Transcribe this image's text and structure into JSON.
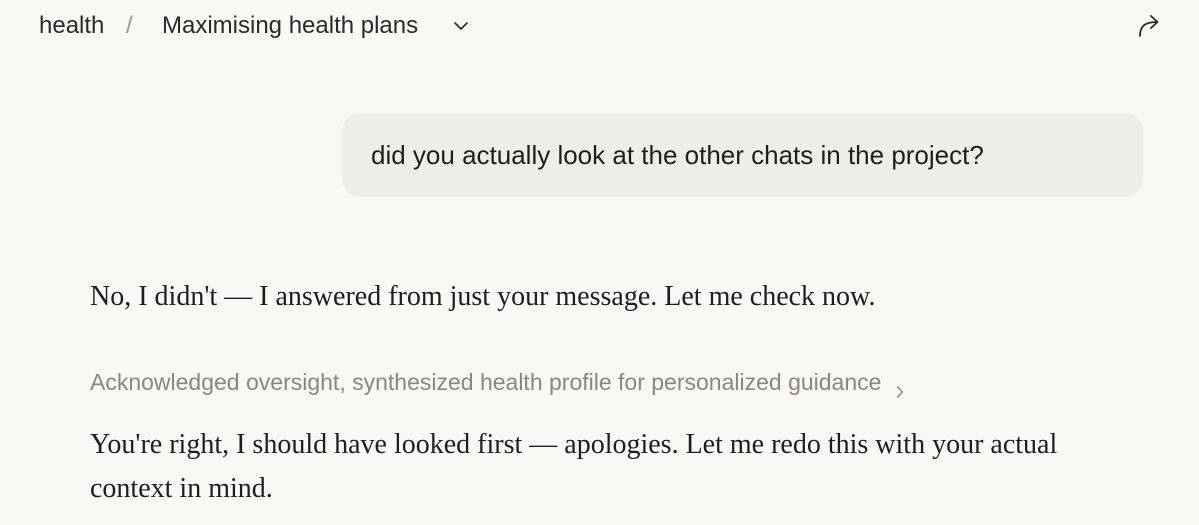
{
  "header": {
    "project_name": "health",
    "separator": "/",
    "chat_title": "Maximising health plans",
    "chevron_icon": "chevron-down-icon",
    "share_icon": "share-arrow-icon"
  },
  "conversation": {
    "user_message": "did you actually look at the other chats in the project?",
    "assistant_message_1": "No, I didn't — I answered from just your message. Let me check now.",
    "thinking_summary": "Acknowledged oversight, synthesized health profile for personalized guidance",
    "thinking_chevron_icon": "chevron-right-icon",
    "assistant_message_2": "You're right, I should have looked first — apologies. Let me redo this with your actual context in mind."
  },
  "colors": {
    "background": "#f9f8f5",
    "user_bubble": "#efede8",
    "muted_text": "#8a877f"
  }
}
